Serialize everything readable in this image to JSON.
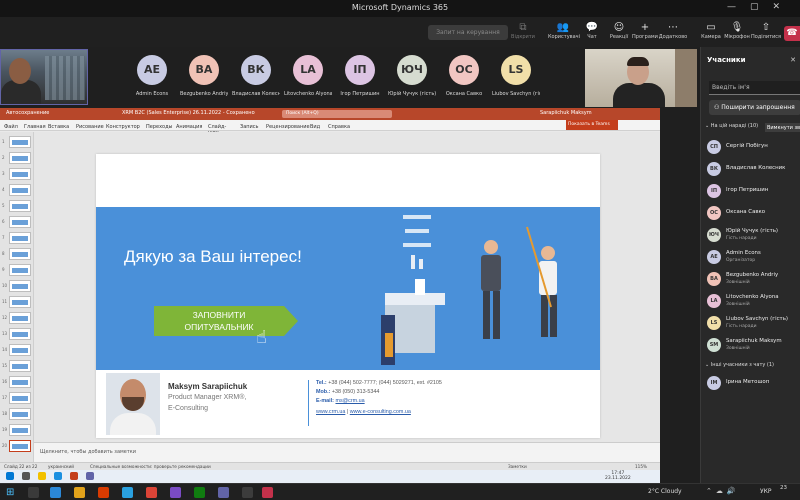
{
  "window": {
    "title": "Microsoft Dynamics 365"
  },
  "toolbar": {
    "share_button": "Запит на керування",
    "items": [
      {
        "label": "Відкрити",
        "icon": "open-window-icon",
        "glyph": "⧉"
      },
      {
        "label": "Користувачі",
        "icon": "people-icon",
        "glyph": "👥"
      },
      {
        "label": "Чат",
        "icon": "chat-icon",
        "glyph": "💬"
      },
      {
        "label": "Реакції",
        "icon": "reactions-icon",
        "glyph": "☺"
      },
      {
        "label": "Програми",
        "icon": "apps-icon",
        "glyph": "+"
      },
      {
        "label": "Додатково",
        "icon": "more-icon",
        "glyph": "⋯"
      },
      {
        "label": "Камера",
        "icon": "camera-icon",
        "glyph": "▭"
      },
      {
        "label": "Мікрофон",
        "icon": "mic-off-icon",
        "glyph": "🎙"
      },
      {
        "label": "Поділитися",
        "icon": "share-tray-icon",
        "glyph": "⇧"
      }
    ]
  },
  "strip": {
    "avatars": [
      {
        "initials": "AE",
        "name": "Admin Econs",
        "color": "#c8cbe3"
      },
      {
        "initials": "BA",
        "name": "Bezgubenko Andriy",
        "color": "#f0c2b6"
      },
      {
        "initials": "ВК",
        "name": "Владислав Колесник",
        "color": "#c8cbe3"
      },
      {
        "initials": "LA",
        "name": "Litovchenko Alyona",
        "color": "#e8c0d6"
      },
      {
        "initials": "ІП",
        "name": "Ігор Петришин",
        "color": "#dcc4e3"
      },
      {
        "initials": "ЮЧ",
        "name": "Юрій Чучук (гість)",
        "color": "#d6dcd0"
      },
      {
        "initials": "ОС",
        "name": "Оксана Савко",
        "color": "#f1c6c2"
      },
      {
        "initials": "LS",
        "name": "Liubov Savchyn (гість)",
        "color": "#f1dfa9"
      }
    ]
  },
  "panel": {
    "title": "Учасники",
    "search_placeholder": "Введіть ім'я",
    "share_invite": "Поширити запрошення",
    "in_meeting": "На цій нараді (10)",
    "mute_all": "Вимкнути звук усім",
    "others": "Інші учасники з чату (1)",
    "people": [
      {
        "initials": "СП",
        "name": "Сергій Побігун",
        "role": "",
        "color": "#c8cbe3"
      },
      {
        "initials": "ВК",
        "name": "Владислав Колесник",
        "role": "",
        "color": "#c8cbe3"
      },
      {
        "initials": "ІП",
        "name": "Ігор Петришин",
        "role": "",
        "color": "#dcc4e3"
      },
      {
        "initials": "ОС",
        "name": "Оксана Савко",
        "role": "",
        "color": "#f1c6c2"
      },
      {
        "initials": "ЮЧ",
        "name": "Юрій Чучук (гість)",
        "role": "Гість наради",
        "color": "#d6dcd0"
      },
      {
        "initials": "AE",
        "name": "Admin Econs",
        "role": "Організатор",
        "color": "#c8cbe3"
      },
      {
        "initials": "BA",
        "name": "Bezgubenko Andriy",
        "role": "Зовнішній",
        "color": "#f0c2b6"
      },
      {
        "initials": "LA",
        "name": "Litovchenko Alyona",
        "role": "Зовнішній",
        "color": "#e8c0d6"
      },
      {
        "initials": "LS",
        "name": "Liubov Savchyn (гість)",
        "role": "Гість наради",
        "color": "#f1dfa9"
      },
      {
        "initials": "SM",
        "name": "Sarapiichuk Maksym",
        "role": "Зовнішній",
        "color": "#cfe0d4"
      }
    ],
    "other_people": [
      {
        "initials": "IM",
        "name": "Ірина Метошоп",
        "role": "",
        "color": "#c8cbe3"
      }
    ]
  },
  "powerpoint": {
    "autosave": "Автосохранение",
    "filename": "XRM B2C (Sales Enterprise) 26.11.2022 - Сохранено",
    "search": "Поиск (Alt+Q)",
    "user": "Sarapiichuk Maksym",
    "ribbon_tabs": [
      "Файл",
      "Главная",
      "Вставка",
      "Рисование",
      "Конструктор",
      "Переходы",
      "Анимация",
      "Слайд-шоу",
      "Запись",
      "Рецензирование",
      "Вид",
      "Справка"
    ],
    "share_tab": "Показать в Teams",
    "slide_numbers": [
      "1",
      "2",
      "3",
      "4",
      "5",
      "6",
      "7",
      "8",
      "9",
      "10",
      "11",
      "12",
      "13",
      "14",
      "15",
      "16",
      "17",
      "18",
      "19",
      "20"
    ],
    "notes": "Щелкните, чтобы добавить заметки",
    "status": {
      "slide": "Слайд 22 из 22",
      "lang": "украинский",
      "accessibility": "Специальные возможности: проверьте рекомендации",
      "notes_btn": "Заметки",
      "zoom": "115%"
    }
  },
  "slide": {
    "thanks": "Дякую за Ваш інтерес!",
    "cta_line1": "ЗАПОВНИТИ",
    "cta_line2": "ОПИТУВАЛЬНИК",
    "sig_name": "Maksym Sarapiichuk",
    "sig_role1": "Product Manager XRM®,",
    "sig_role2": "E-Consulting",
    "tel_label": "Tel.:",
    "tel_value": "+38 (044) 502-7777; (044) 5029271, ext. #2105",
    "mob_label": "Mob.:",
    "mob_value": "+38 (050) 313-5344",
    "email_label": "E-mail:",
    "email_value": "ms@crm.ua",
    "site1": "www.crm.ua",
    "site_sep": " | ",
    "site2": "www.e-consulting.com.ua"
  },
  "remote_taskbar": {
    "time": "17:47",
    "date": "23.11.2022"
  },
  "taskbar": {
    "weather": "2°C  Cloudy",
    "lang": "УКР",
    "time": "23"
  }
}
